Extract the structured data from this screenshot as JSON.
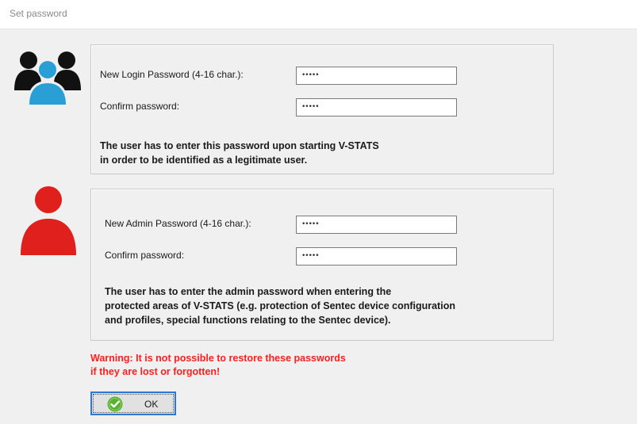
{
  "window": {
    "title": "Set password"
  },
  "login_group": {
    "new_label": "New Login Password (4-16 char.):",
    "new_value": "•••••",
    "confirm_label": "Confirm password:",
    "confirm_value": "•••••",
    "info_line1": "The user has to enter this password upon starting V-STATS",
    "info_line2": "in order to be identified as a legitimate user."
  },
  "admin_group": {
    "new_label": "New Admin Password (4-16 char.):",
    "new_value": "•••••",
    "confirm_label": "Confirm password:",
    "confirm_value": "•••••",
    "info_line1": "The user has to enter the admin password when entering the",
    "info_line2": "protected areas of V-STATS (e.g. protection of Sentec device configuration",
    "info_line3": "and profiles, special functions relating to the Sentec device)."
  },
  "warning": {
    "line1": "Warning: It is not possible to restore these passwords",
    "line2": "if they are lost or forgotten!"
  },
  "ok_button": {
    "label": "OK"
  },
  "icons": {
    "users": "users-group-icon",
    "admin": "admin-user-icon",
    "ok": "check-circle-icon"
  },
  "colors": {
    "users_front": "#2a9fd6",
    "users_back": "#111111",
    "admin": "#e0201c",
    "warning": "#ff2020",
    "ok_check": "#59b22f",
    "button_focus": "#2e78d1"
  }
}
